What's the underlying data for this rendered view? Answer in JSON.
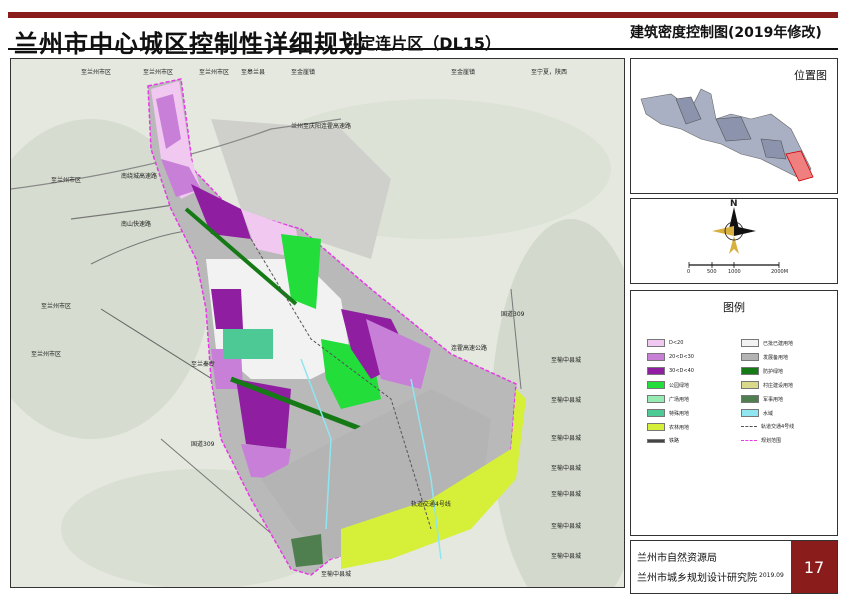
{
  "header": {
    "title": "兰州市中心城区控制性详细规划",
    "subtitle": "--定连片区（DL15）",
    "map_title": "建筑密度控制图(2019年修改)"
  },
  "location_map": {
    "title": "位置图"
  },
  "north": {
    "label": "N"
  },
  "scale": {
    "ticks": [
      "0",
      "500",
      "1000",
      "2000M"
    ]
  },
  "legend": {
    "title": "图例",
    "left": [
      {
        "label": "D<20",
        "color": "#f0c8f0"
      },
      {
        "label": "20<D<30",
        "color": "#c87fd8"
      },
      {
        "label": "30<D<40",
        "color": "#8f1ea0"
      },
      {
        "label": "公园绿地",
        "color": "#22dd3a"
      },
      {
        "label": "广场用地",
        "color": "#96eab4"
      },
      {
        "label": "特殊用地",
        "color": "#4cc994"
      },
      {
        "label": "农林用地",
        "color": "#d6f03a"
      },
      {
        "label": "铁路",
        "color": "#444444"
      }
    ],
    "right": [
      {
        "label": "已批已建用地",
        "color": "#f2f2f2"
      },
      {
        "label": "发展备用地",
        "color": "#b4b4b4"
      },
      {
        "label": "防护绿地",
        "color": "#157a16"
      },
      {
        "label": "村庄建设用地",
        "color": "#d9d98a"
      },
      {
        "label": "军事用地",
        "color": "#4f7f4f"
      },
      {
        "label": "水域",
        "color": "#8fe6f0"
      },
      {
        "label": "轨道交通4号线",
        "color": "#777777"
      },
      {
        "label": "规划范围",
        "color": "#e838e8"
      }
    ]
  },
  "footer": {
    "org1": "兰州市自然资源局",
    "org2": "兰州市城乡规划设计研究院",
    "date": "2019.09",
    "page": "17"
  },
  "map_labels": [
    "至兰州市区",
    "至兰州市区",
    "至兰州市区",
    "至皋兰县",
    "至金崖镇",
    "至金崖镇",
    "至宁夏，陕西",
    "兰州至庆阳连霍高速路",
    "至兰州市区",
    "南绕城高速路",
    "南山快速路",
    "至兰州市区",
    "国道309",
    "连霍高速公路",
    "至榆中县城",
    "至榆中县城",
    "至榆中县城",
    "至榆中县城",
    "至榆中县城",
    "至榆中县城",
    "至榆中县城",
    "至兰州市区",
    "国道309",
    "至兰秦专",
    "轨道交通4号线",
    "至榆中县城"
  ]
}
